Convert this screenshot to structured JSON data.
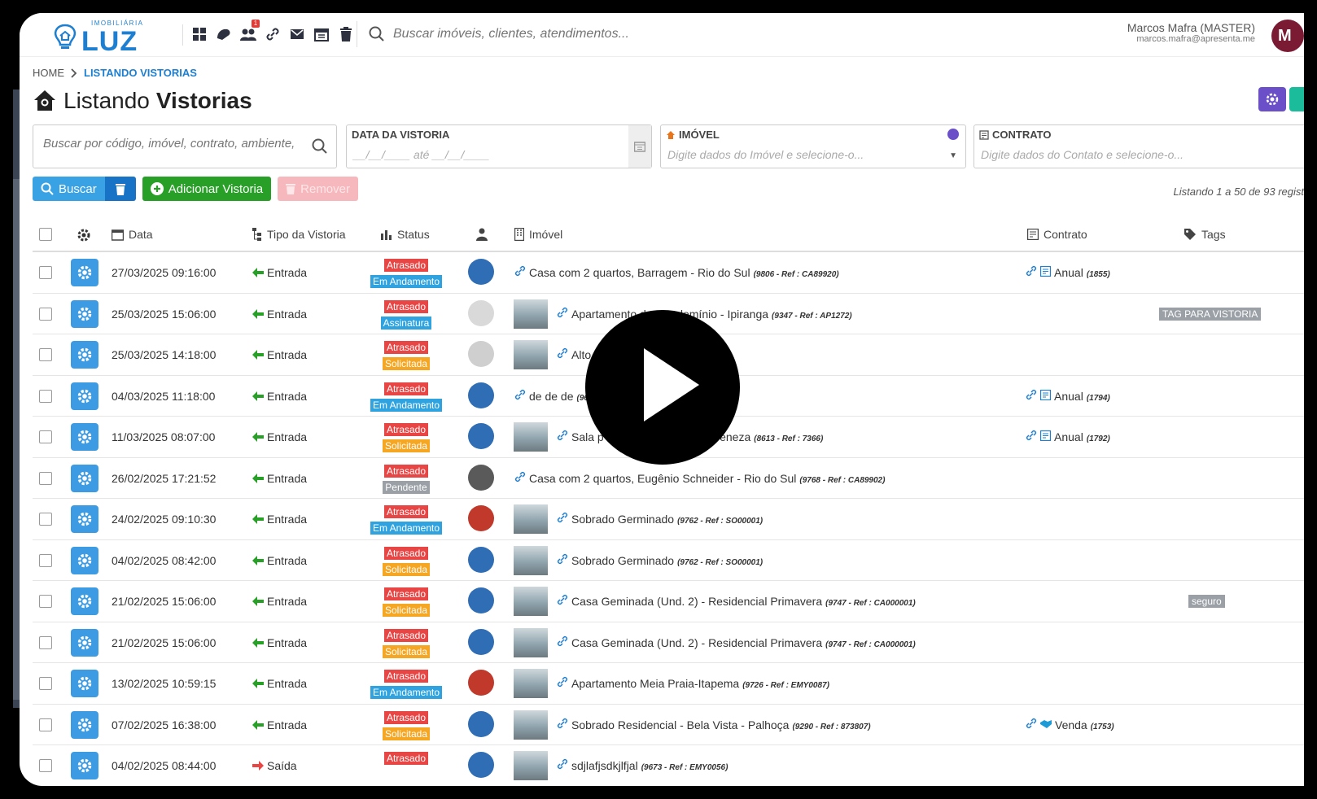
{
  "brand": {
    "small": "IMOBILIÁRIA",
    "big": "LUZ"
  },
  "search": {
    "placeholder": "Buscar imóveis, clientes, atendimentos..."
  },
  "notifications": {
    "count": "1"
  },
  "user": {
    "name": "Marcos Mafra (MASTER)",
    "email": "marcos.mafra@apresenta.me",
    "initial": "M"
  },
  "breadcrumb": {
    "home": "HOME",
    "current": "LISTANDO VISTORIAS"
  },
  "page": {
    "title_light": "Listando",
    "title_bold": "Vistorias"
  },
  "filters": {
    "search_placeholder": "Buscar por código, imóvel, contrato, ambiente,",
    "date_label": "DATA DA VISTORIA",
    "date_placeholder": "__/__/____  até __/__/____",
    "imovel_label": "IMÓVEL",
    "imovel_placeholder": "Digite dados do Imóvel e selecione-o...",
    "contrato_label": "CONTRATO",
    "contrato_placeholder": "Digite dados do Contato e selecione-o..."
  },
  "buttons": {
    "buscar": "Buscar",
    "adicionar": "Adicionar Vistoria",
    "remover": "Remover"
  },
  "listing": "Listando 1 a 50 de 93 regist",
  "columns": {
    "data": "Data",
    "tipo": "Tipo da Vistoria",
    "status": "Status",
    "imovel": "Imóvel",
    "contrato": "Contrato",
    "tags": "Tags"
  },
  "colors": {
    "accent": "#1d7fd1",
    "late": "#e84545",
    "progress": "#2ea3e0",
    "requested": "#f5a623",
    "pending": "#9aa0a6",
    "add": "#28a028"
  },
  "rows": [
    {
      "date": "27/03/2025 09:16:00",
      "tipo": "Entrada",
      "status1": "Atrasado",
      "status2": "Em Andamento",
      "s2": "blue",
      "imovel": "Casa com 2 quartos, Barragem - Rio do Sul",
      "ref": "(9806 - Ref : CA89920)",
      "thumb": false,
      "contrato": "Anual",
      "cref": "(1855)",
      "ctype": "contract",
      "tag": ""
    },
    {
      "date": "25/03/2025 15:06:00",
      "tipo": "Entrada",
      "status1": "Atrasado",
      "status2": "Assinatura",
      "s2": "blue",
      "imovel": "Apartamento de Condomínio - Ipiranga",
      "ref": "(9347 - Ref : AP1272)",
      "thumb": true,
      "contrato": "",
      "cref": "",
      "ctype": "",
      "tag": "TAG PARA VISTORIA"
    },
    {
      "date": "25/03/2025 14:18:00",
      "tipo": "Entrada",
      "status1": "Atrasado",
      "status2": "Solicitada",
      "s2": "orange",
      "imovel": "Alto P                                  que - Campinas Ga",
      "ref": "(7120)",
      "thumb": true,
      "contrato": "",
      "cref": "",
      "ctype": "",
      "tag": ""
    },
    {
      "date": "04/03/2025 11:18:00",
      "tipo": "Entrada",
      "status1": "Atrasado",
      "status2": "Em Andamento",
      "s2": "blue",
      "imovel": "de de de",
      "ref": "(96",
      "thumb": false,
      "contrato": "Anual",
      "cref": "(1794)",
      "ctype": "contract",
      "tag": ""
    },
    {
      "date": "11/03/2025 08:07:00",
      "tipo": "Entrada",
      "status1": "Atrasado",
      "status2": "Solicitada",
      "s2": "orange",
      "imovel": "Sala p                                a/MG – 544m² – Ed. Veneza",
      "ref": "(8613 - Ref : 7366)",
      "thumb": true,
      "contrato": "Anual",
      "cref": "(1792)",
      "ctype": "contract",
      "tag": ""
    },
    {
      "date": "26/02/2025 17:21:52",
      "tipo": "Entrada",
      "status1": "Atrasado",
      "status2": "Pendente",
      "s2": "gray",
      "imovel": "Casa com 2 quartos, Eugênio Schneider - Rio do Sul",
      "ref": "(9768 - Ref : CA89902)",
      "thumb": false,
      "contrato": "",
      "cref": "",
      "ctype": "",
      "tag": ""
    },
    {
      "date": "24/02/2025 09:10:30",
      "tipo": "Entrada",
      "status1": "Atrasado",
      "status2": "Em Andamento",
      "s2": "blue",
      "imovel": "Sobrado Germinado",
      "ref": "(9762 - Ref : SO00001)",
      "thumb": true,
      "contrato": "",
      "cref": "",
      "ctype": "",
      "tag": ""
    },
    {
      "date": "04/02/2025 08:42:00",
      "tipo": "Entrada",
      "status1": "Atrasado",
      "status2": "Solicitada",
      "s2": "orange",
      "imovel": "Sobrado Germinado",
      "ref": "(9762 - Ref : SO00001)",
      "thumb": true,
      "contrato": "",
      "cref": "",
      "ctype": "",
      "tag": ""
    },
    {
      "date": "21/02/2025 15:06:00",
      "tipo": "Entrada",
      "status1": "Atrasado",
      "status2": "Solicitada",
      "s2": "orange",
      "imovel": "Casa Geminada (Und. 2) - Residencial Primavera",
      "ref": "(9747 - Ref : CA000001)",
      "thumb": true,
      "contrato": "",
      "cref": "",
      "ctype": "",
      "tag": "seguro"
    },
    {
      "date": "21/02/2025 15:06:00",
      "tipo": "Entrada",
      "status1": "Atrasado",
      "status2": "Solicitada",
      "s2": "orange",
      "imovel": "Casa Geminada (Und. 2) - Residencial Primavera",
      "ref": "(9747 - Ref : CA000001)",
      "thumb": true,
      "contrato": "",
      "cref": "",
      "ctype": "",
      "tag": ""
    },
    {
      "date": "13/02/2025 10:59:15",
      "tipo": "Entrada",
      "status1": "Atrasado",
      "status2": "Em Andamento",
      "s2": "blue",
      "imovel": "Apartamento Meia Praia-Itapema",
      "ref": "(9726 - Ref : EMY0087)",
      "thumb": true,
      "contrato": "",
      "cref": "",
      "ctype": "",
      "tag": ""
    },
    {
      "date": "07/02/2025 16:38:00",
      "tipo": "Entrada",
      "status1": "Atrasado",
      "status2": "Solicitada",
      "s2": "orange",
      "imovel": "Sobrado Residencial - Bela Vista - Palhoça",
      "ref": "(9290 - Ref : 873807)",
      "thumb": true,
      "contrato": "Venda",
      "cref": "(1753)",
      "ctype": "sale",
      "tag": ""
    },
    {
      "date": "04/02/2025 08:44:00",
      "tipo": "Saída",
      "status1": "Atrasado",
      "status2": "",
      "s2": "",
      "imovel": "sdjlafjsdkjlfjal",
      "ref": "(9673 - Ref : EMY0056)",
      "thumb": true,
      "contrato": "",
      "cref": "",
      "ctype": "",
      "tag": ""
    }
  ]
}
